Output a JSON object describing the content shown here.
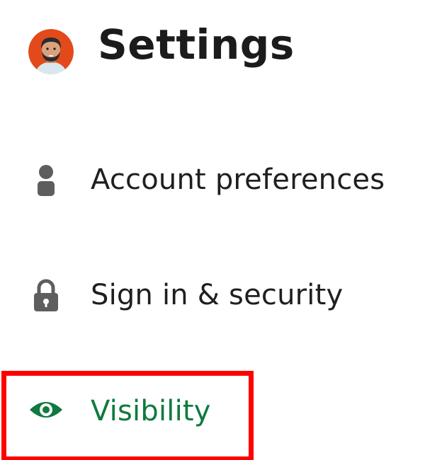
{
  "header": {
    "title": "Settings",
    "avatar_icon": "user-avatar-icon"
  },
  "nav": {
    "items": [
      {
        "label": "Account preferences",
        "icon": "person-icon",
        "active": false
      },
      {
        "label": "Sign in & security",
        "icon": "lock-icon",
        "active": false
      },
      {
        "label": "Visibility",
        "icon": "eye-icon",
        "active": true
      }
    ]
  },
  "colors": {
    "text": "#1f1f1f",
    "icon_gray": "#5e5e5e",
    "active_green": "#0f7a3e",
    "highlight_red": "#ff0000",
    "avatar_bg": "#e24a1b"
  }
}
